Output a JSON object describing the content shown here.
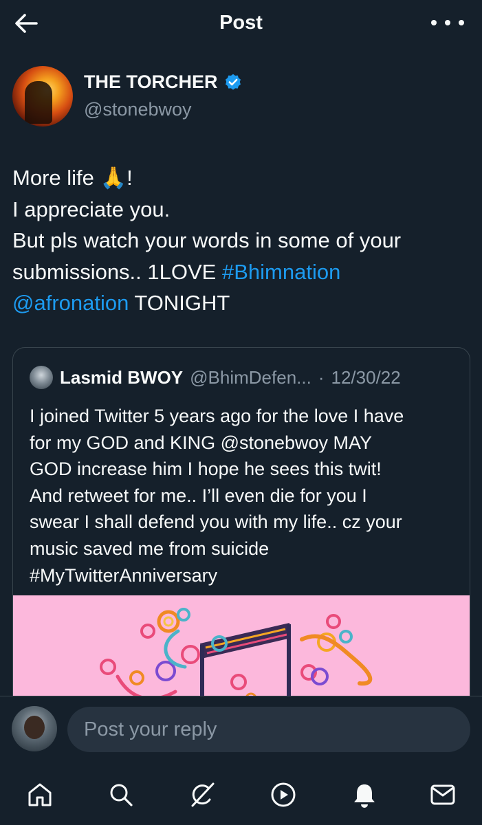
{
  "header": {
    "title": "Post",
    "back_icon": "arrow-left-icon",
    "more_icon": "more-dots-icon"
  },
  "post": {
    "author_name": "THE TORCHER",
    "author_handle": "@stonebwoy",
    "verified_color": "#1d9bf0",
    "text_lines": [
      "More life 🙏!",
      "I appreciate you.",
      "But pls watch your words in some of your",
      "submissions.. 1LOVE",
      "#Bhimnation",
      "@afronation",
      "TONIGHT"
    ]
  },
  "quote": {
    "author_name": "Lasmid BWOY",
    "author_handle": "@BhimDefen...",
    "separator": "·",
    "date": "12/30/22",
    "text_lines": [
      "I joined Twitter 5 years ago for the love I have",
      "for my GOD and KING @stonebwoy MAY",
      "GOD increase him I hope he sees this twit!",
      "And retweet for me.. I’ll even die for you I",
      "swear I shall defend you with my life.. cz your",
      "music saved me from suicide",
      "#MyTwitterAnniversary"
    ],
    "media_color": "#fcb8dc"
  },
  "reply": {
    "placeholder": "Post your reply"
  },
  "nav": {
    "items": [
      "home-icon",
      "search-icon",
      "grok-icon",
      "video-icon",
      "notifications-icon",
      "messages-icon"
    ]
  },
  "colors": {
    "background": "#15202b",
    "text": "#f7f9f9",
    "secondary": "#8b98a5",
    "accent": "#1d9bf0",
    "border": "#38444d"
  }
}
